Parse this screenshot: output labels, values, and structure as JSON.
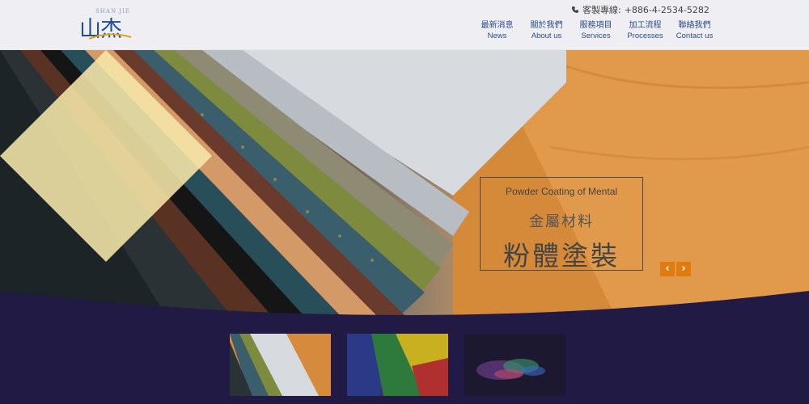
{
  "header": {
    "logo_text": "山杰",
    "logo_sub": "SHAN JIE",
    "phone_label": "客製專線:",
    "phone_number": "+886-4-2534-5282",
    "nav": [
      {
        "zh": "最新消息",
        "en": "News"
      },
      {
        "zh": "關於我們",
        "en": "About us"
      },
      {
        "zh": "服務項目",
        "en": "Services"
      },
      {
        "zh": "加工流程",
        "en": "Processes"
      },
      {
        "zh": "聯絡我們",
        "en": "Contact us"
      }
    ]
  },
  "hero": {
    "caption_en": "Powder Coating of Mental",
    "caption_zh_small": "金屬材料",
    "caption_zh_large": "粉體塗裝",
    "prev_icon": "‹",
    "next_icon": "›"
  },
  "colors": {
    "brand_blue": "#2a4c8d",
    "accent_orange": "#e07b10",
    "band_navy": "#201a44",
    "diamond_yellow": "#f6e7a8"
  },
  "thumbnails": [
    {
      "name": "coating-samples"
    },
    {
      "name": "colored-panels"
    },
    {
      "name": "powder-burst"
    }
  ]
}
